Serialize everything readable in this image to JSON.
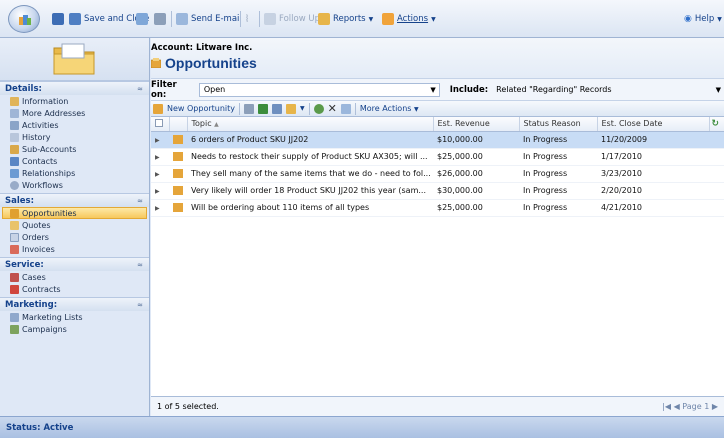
{
  "toolbar": {
    "save_close": "Save and Close",
    "send_email": "Send E-mail",
    "follow_up": "Follow Up",
    "reports": "Reports",
    "actions": "Actions",
    "help": "Help"
  },
  "header": {
    "account": "Account: Litware Inc.",
    "title": "Opportunities"
  },
  "filter": {
    "filter_label": "Filter on:",
    "filter_value": "Open",
    "include_label": "Include:",
    "include_value": "Related \"Regarding\" Records"
  },
  "gridtoolbar": {
    "new_opportunity": "New Opportunity",
    "more_actions": "More Actions"
  },
  "nav": {
    "details": {
      "header": "Details:",
      "items": [
        "Information",
        "More Addresses",
        "Activities",
        "History",
        "Sub-Accounts",
        "Contacts",
        "Relationships",
        "Workflows"
      ]
    },
    "sales": {
      "header": "Sales:",
      "items": [
        "Opportunities",
        "Quotes",
        "Orders",
        "Invoices"
      ]
    },
    "service": {
      "header": "Service:",
      "items": [
        "Cases",
        "Contracts"
      ]
    },
    "marketing": {
      "header": "Marketing:",
      "items": [
        "Marketing Lists",
        "Campaigns"
      ]
    }
  },
  "grid": {
    "columns": [
      "Topic",
      "Est. Revenue",
      "Status Reason",
      "Est. Close Date"
    ],
    "rows": [
      [
        "6 orders of Product SKU JJ202",
        "$10,000.00",
        "In Progress",
        "11/20/2009"
      ],
      [
        "Needs to restock their supply of Product SKU AX305; will ...",
        "$25,000.00",
        "In Progress",
        "1/17/2010"
      ],
      [
        "They sell many of the same items that we do - need to fol...",
        "$26,000.00",
        "In Progress",
        "3/23/2010"
      ],
      [
        "Very likely will order 18 Product SKU JJ202 this year (sam...",
        "$30,000.00",
        "In Progress",
        "2/20/2010"
      ],
      [
        "Will be ordering about 110 items of all types",
        "$25,000.00",
        "In Progress",
        "4/21/2010"
      ]
    ],
    "selection": "1 of 5 selected.",
    "pager": "Page 1"
  },
  "status": "Status: Active"
}
